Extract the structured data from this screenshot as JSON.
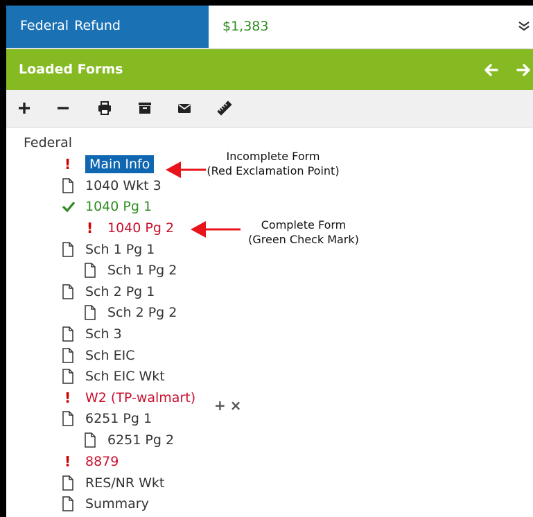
{
  "refund": {
    "label": "Federal  Refund",
    "amount": "$1,383",
    "toggle_icon": "double-chevron-down-icon"
  },
  "forms_header": {
    "title": "Loaded Forms",
    "back_icon": "arrow-left-icon",
    "forward_icon": "arrow-right-icon"
  },
  "toolbar": {
    "icons": [
      "plus-icon",
      "minus-icon",
      "print-icon",
      "archive-icon",
      "email-icon",
      "ruler-icon"
    ]
  },
  "tree": {
    "root_label": "Federal",
    "items": [
      {
        "label": "Main Info",
        "status": "incomplete",
        "selected": true
      },
      {
        "label": "1040 Wkt 3",
        "status": "document"
      },
      {
        "label": "1040 Pg 1",
        "status": "complete"
      },
      {
        "label": "1040 Pg 2",
        "status": "incomplete"
      },
      {
        "label": "Sch 1 Pg 1",
        "status": "document"
      },
      {
        "label": "Sch 1 Pg 2",
        "status": "document"
      },
      {
        "label": "Sch 2 Pg 1",
        "status": "document"
      },
      {
        "label": "Sch 2 Pg 2",
        "status": "document"
      },
      {
        "label": "Sch 3",
        "status": "document"
      },
      {
        "label": "Sch EIC",
        "status": "document"
      },
      {
        "label": "Sch EIC Wkt",
        "status": "document"
      },
      {
        "label": "W2 (TP-walmart)",
        "status": "incomplete"
      },
      {
        "label": "6251 Pg 1",
        "status": "document"
      },
      {
        "label": "6251 Pg 2",
        "status": "document"
      },
      {
        "label": "8879",
        "status": "incomplete"
      },
      {
        "label": "RES/NR Wkt",
        "status": "document"
      },
      {
        "label": "Summary",
        "status": "document"
      }
    ],
    "row_actions": {
      "add": "+",
      "remove": "×"
    }
  },
  "annotations": {
    "incomplete_line1": "Incomplete Form",
    "incomplete_line2": "(Red Exclamation Point)",
    "complete_line1": "Complete Form",
    "complete_line2": "(Green Check Mark)"
  },
  "colors": {
    "refund_blue": "#1a72b5",
    "forms_green": "#85ba23",
    "incomplete_red": "#c8102e",
    "complete_green": "#2e8b1f",
    "arrow_red": "#e8141c"
  }
}
